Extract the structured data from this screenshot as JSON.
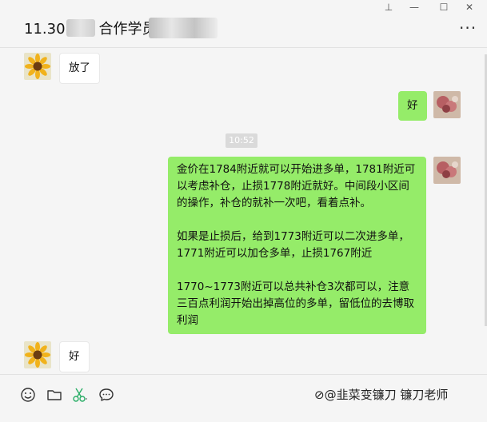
{
  "window": {
    "pin": "⊥",
    "minimize": "—",
    "maximize": "☐",
    "close": "✕"
  },
  "header": {
    "title": "11.30",
    "title_tail": "合作学员",
    "more": "···"
  },
  "messages": {
    "m1": "放了",
    "m2": "好",
    "time": "10:52",
    "m3": "金价在1784附近就可以开始进多单，1781附近可以考虑补仓，止损1778附近就好。中间段小区间的操作，补仓的就补一次吧，看着点补。\n\n如果是止损后，给到1773附近可以二次进多单，1771附近可以加仓多单，止损1767附近\n\n1770~1773附近可以总共补仓3次都可以，注意三百点利润开始出掉高位的多单，留低位的去博取利润",
    "m4": "好"
  },
  "watermark": "⊘@韭菜变镰刀  镰刀老师",
  "colors": {
    "own_bubble": "#95ec69",
    "other_bubble": "#ffffff",
    "background": "#f5f5f5"
  },
  "icons": [
    "emoji-icon",
    "folder-icon",
    "scissors-icon",
    "chat-history-icon"
  ]
}
